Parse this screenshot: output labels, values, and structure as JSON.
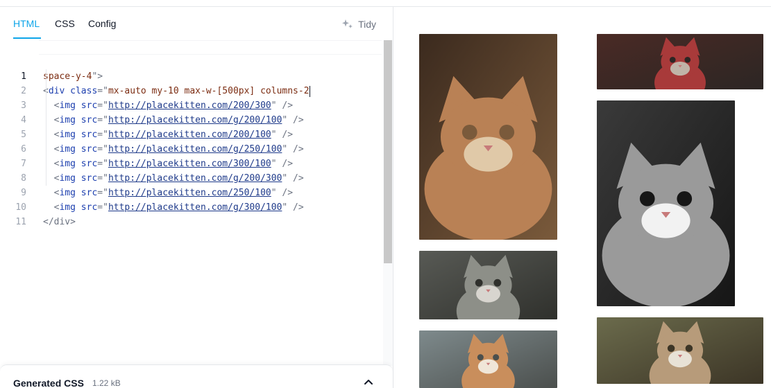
{
  "tabs": [
    {
      "label": "HTML"
    },
    {
      "label": "CSS"
    },
    {
      "label": "Config"
    }
  ],
  "toolbar": {
    "tidy_label": "Tidy",
    "tidy_icon": "sparkles-icon"
  },
  "code": {
    "line_numbers": [
      "1",
      "2",
      "3",
      "4",
      "5",
      "6",
      "7",
      "8",
      "9",
      "10",
      "11"
    ],
    "div_open": {
      "class_value": "mx-auto my-10 max-w-[500px] columns-2",
      "class_value_cont": "space-y-4"
    },
    "images": [
      "http://placekitten.com/200/300",
      "http://placekitten.com/g/200/100",
      "http://placekitten.com/200/100",
      "http://placekitten.com/g/250/100",
      "http://placekitten.com/300/100",
      "http://placekitten.com/g/200/300",
      "http://placekitten.com/250/100",
      "http://placekitten.com/g/300/100"
    ],
    "div_close": "</div>"
  },
  "generated_css": {
    "title": "Generated CSS",
    "size": "1.22 kB",
    "icon": "chevron-up-icon"
  },
  "preview": {
    "images": [
      {
        "name": "kitten-calico-closeup",
        "palette": [
          "#3b2a1e",
          "#b98155",
          "#e0c9a8",
          "#7a5a3b"
        ]
      },
      {
        "name": "kitten-grey-tabby",
        "palette": [
          "#585a55",
          "#8d8f88",
          "#d8d5cf",
          "#2f302c"
        ]
      },
      {
        "name": "kitten-orange-white",
        "palette": [
          "#7e8a8c",
          "#c98e5c",
          "#f0e6d8",
          "#4b4f4d"
        ]
      },
      {
        "name": "kitten-red-background",
        "palette": [
          "#4a2a25",
          "#a83a3a",
          "#c0b4a8",
          "#2c2624"
        ]
      },
      {
        "name": "kitten-bw-portrait",
        "palette": [
          "#3a3a3a",
          "#9a9a9a",
          "#f2f2f2",
          "#161616"
        ]
      },
      {
        "name": "kitten-tabby-lying",
        "palette": [
          "#6b6b4c",
          "#b79b7a",
          "#e8e2d6",
          "#3c3526"
        ]
      }
    ]
  }
}
